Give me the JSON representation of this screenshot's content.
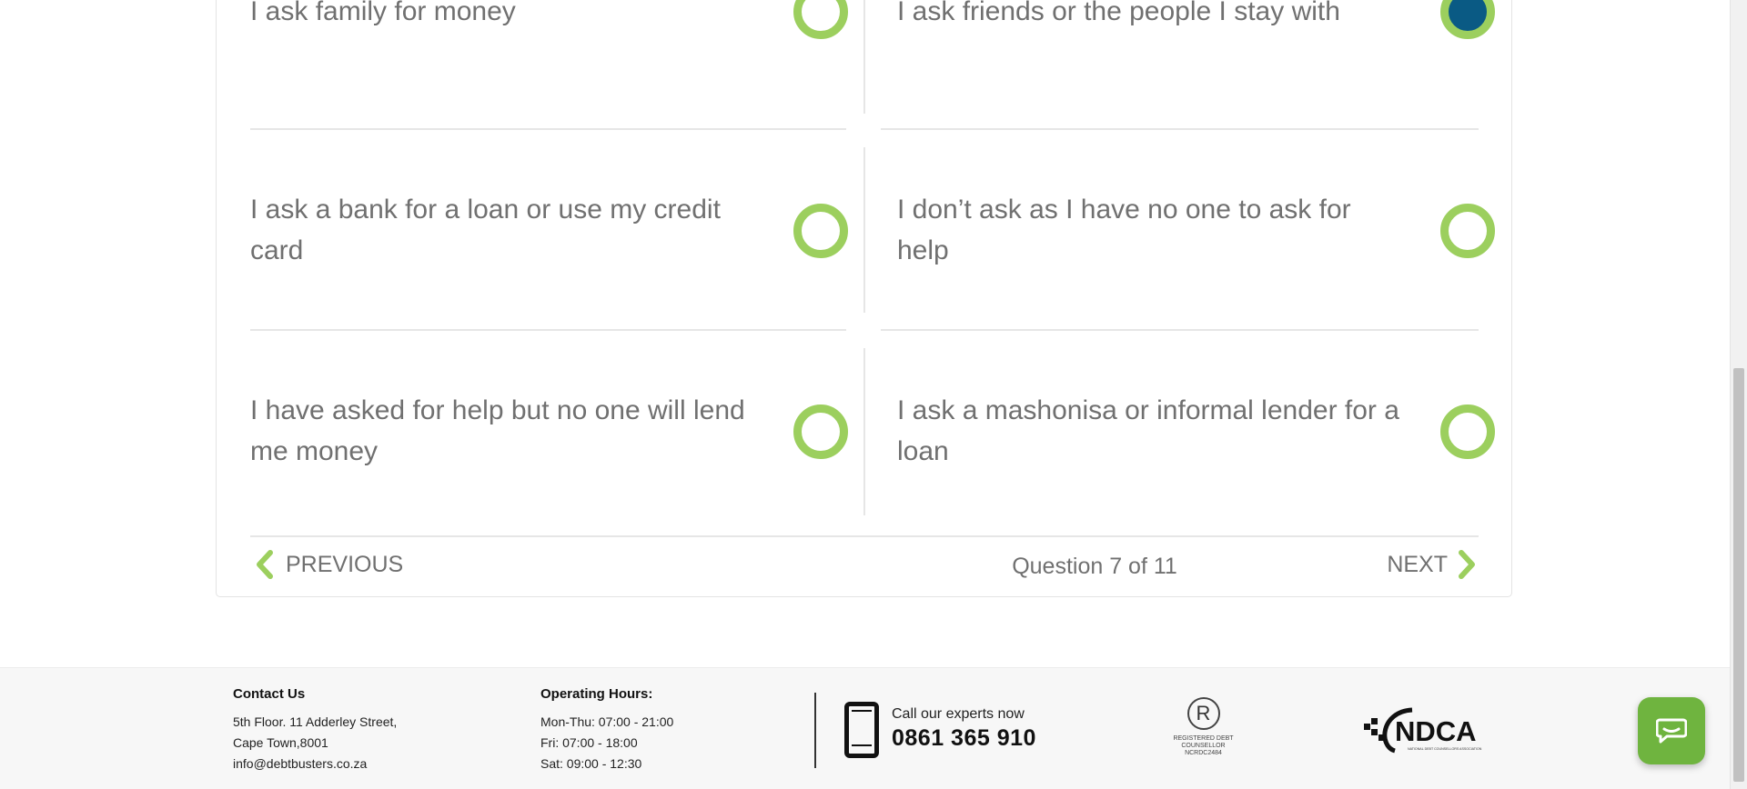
{
  "question": {
    "options": [
      {
        "label": "I ask family for money",
        "selected": false
      },
      {
        "label": "I ask friends or the people I stay with",
        "selected": true
      },
      {
        "label": "I ask a bank for a loan or use my credit card",
        "selected": false
      },
      {
        "label": "I don’t ask as I have no one to ask for help",
        "selected": false
      },
      {
        "label": "I have asked for help but no one will lend me money",
        "selected": false
      },
      {
        "label": "I ask a mashonisa or informal lender for a loan",
        "selected": false
      }
    ],
    "nav": {
      "previous_label": "PREVIOUS",
      "next_label": "NEXT",
      "counter": "Question 7 of 11"
    }
  },
  "footer": {
    "contact": {
      "title": "Contact Us",
      "lines": [
        "5th Floor. 11 Adderley Street,",
        "Cape Town,8001",
        "info@debtbusters.co.za"
      ]
    },
    "hours": {
      "title": "Operating Hours:",
      "lines": [
        "Mon-Thu: 07:00 - 21:00",
        "Fri: 07:00 - 18:00",
        "Sat: 09:00 - 12:30"
      ]
    },
    "call": {
      "label": "Call our experts now",
      "number": "0861 365 910"
    },
    "registered_badge": {
      "symbol": "R",
      "text": "REGISTERED DEBT COUNSELLOR NCRDC2484"
    },
    "ndca_logo": {
      "name": "NDCA",
      "tagline": "NATIONAL DEBT COUNSELLORS ASSOCIATION"
    }
  },
  "colors": {
    "accent_green": "#9ccf5e",
    "selected_blue": "#0a5a84",
    "text_gray": "#707070",
    "chat_green": "#6fb43f"
  },
  "icons": {
    "chat": "chat-bubble-icon",
    "phone": "phone-icon",
    "prev": "chevron-left-icon",
    "next": "chevron-right-icon"
  }
}
